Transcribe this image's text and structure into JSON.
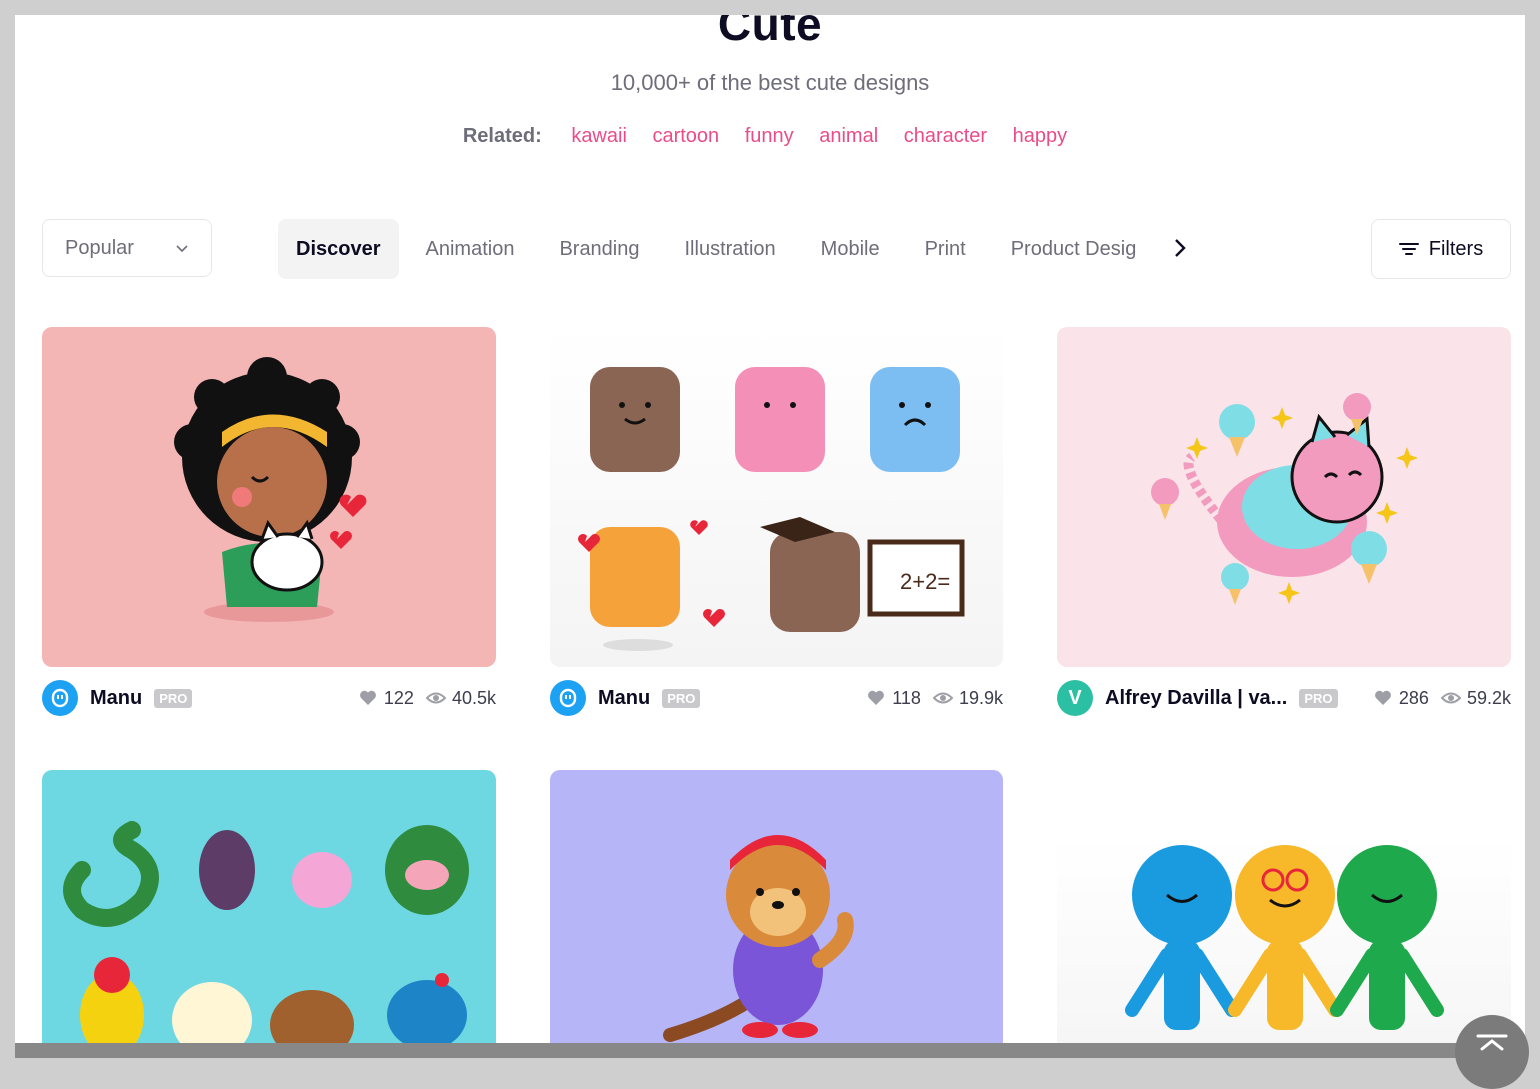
{
  "header": {
    "title": "Cute",
    "subtitle": "10,000+ of the best cute designs",
    "related_label": "Related:",
    "related_tags": [
      "kawaii",
      "cartoon",
      "funny",
      "animal",
      "character",
      "happy"
    ]
  },
  "toolbar": {
    "sort_value": "Popular",
    "categories": [
      "Discover",
      "Animation",
      "Branding",
      "Illustration",
      "Mobile",
      "Print",
      "Product Desig"
    ],
    "active_category": "Discover",
    "filters_label": "Filters"
  },
  "shots": [
    {
      "author": "Manu",
      "pro": "PRO",
      "likes": "122",
      "views": "40.5k",
      "avatar_letter": "",
      "avatar_color": "#1da1f2",
      "bg": "#f4b5b5"
    },
    {
      "author": "Manu",
      "pro": "PRO",
      "likes": "118",
      "views": "19.9k",
      "avatar_letter": "",
      "avatar_color": "#1da1f2",
      "bg": "#f7f7f7"
    },
    {
      "author": "Alfrey Davilla | va...",
      "pro": "PRO",
      "likes": "286",
      "views": "59.2k",
      "avatar_letter": "V",
      "avatar_color": "#2bc0a3",
      "bg": "#fae4ea"
    },
    {
      "bg": "#6ed8e2"
    },
    {
      "bg": "#b6b5f7"
    },
    {
      "bg": "#ffffff"
    }
  ],
  "colors": {
    "accent": "#ea4c89",
    "text_dark": "#0d0c22",
    "text_muted": "#6e6d7a"
  }
}
